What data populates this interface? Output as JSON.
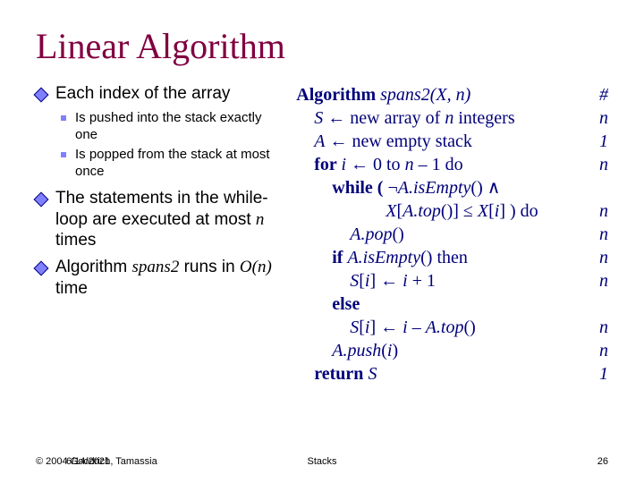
{
  "title": "Linear Algorithm",
  "left": {
    "b1": "Each index of the array",
    "b1a": "Is pushed into the stack exactly one",
    "b1b": "Is popped from the stack at most once",
    "b2_pre": "The statements in the while-loop are executed at most ",
    "b2_n": "n",
    "b2_post": " times",
    "b3_pre": "Algorithm ",
    "b3_spans2": "spans2",
    "b3_mid": " runs in ",
    "b3_on": "O(n)",
    "b3_post": " time"
  },
  "alg": {
    "l1": {
      "text": "Algorithm ",
      "call": "spans2(X, n)",
      "count": "#"
    },
    "l2": {
      "pre": "    ",
      "s": "S",
      "arrow": " ← new array of ",
      "n": "n",
      "post": " integers",
      "count": "n"
    },
    "l3": {
      "pre": "    ",
      "a": "A",
      "post": " ← new empty stack",
      "count": "1"
    },
    "l4": {
      "pre": "    ",
      "for": "for ",
      "i": "i",
      "mid": " ← 0 to ",
      "n": "n",
      "post": " – 1 do",
      "count": "n"
    },
    "l5": {
      "pre": "        ",
      "while": "while ( ",
      "neg": "¬",
      "a": "A.isEmpty",
      "post": "() ∧"
    },
    "l6": {
      "pre": "                    ",
      "x": "X",
      "b1": "[",
      "a": "A.top",
      "p": "()] ≤ ",
      "x2": "X",
      "b2": "[",
      "i": "i",
      "b3": "] ) do",
      "count": "n"
    },
    "l7": {
      "pre": "            ",
      "a": "A.pop",
      "post": "()",
      "count": "n"
    },
    "l8": {
      "pre": "        ",
      "if": "if ",
      "a": "A.isEmpty",
      "post": "() then",
      "count": "n"
    },
    "l9": {
      "pre": "            ",
      "s": "S",
      "b1": "[",
      "i": "i",
      "b2": "] ← ",
      "i2": "i",
      "plus": " + 1",
      "count": "n"
    },
    "l10": {
      "pre": "        ",
      "else": "else"
    },
    "l11": {
      "pre": "            ",
      "s": "S",
      "b1": "[",
      "i": "i",
      "b2": "] ← ",
      "i2": "i",
      "minus": " – ",
      "a": "A.top",
      "post": "()",
      "count": "n"
    },
    "l12": {
      "pre": "        ",
      "a": "A.push",
      "p1": "(",
      "i": "i",
      "p2": ")",
      "count": "n"
    },
    "l13": {
      "pre": "    ",
      "ret": "return ",
      "s": "S",
      "count": "1"
    }
  },
  "footer": {
    "left": "© 2004 Goodrich, Tamassia",
    "left_overlay": "6/14/2021",
    "center": "Stacks",
    "right": "26"
  }
}
